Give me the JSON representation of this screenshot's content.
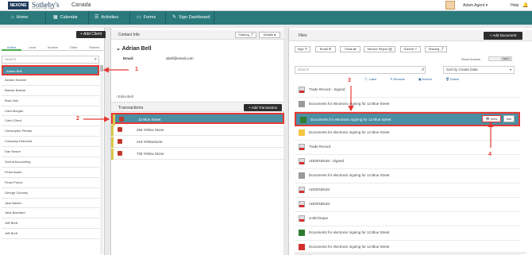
{
  "header": {
    "logo_text": "NEXONE",
    "brand": "Sotheby's",
    "brand_sub": "INTERNATIONAL REALTY",
    "region": "Canada",
    "user_name": "Adam Agent ▾",
    "help": "Help",
    "bell_icon": "bell-icon"
  },
  "nav": {
    "items": [
      {
        "label": "Home",
        "icon": "home-icon"
      },
      {
        "label": "Calendar",
        "icon": "calendar-icon"
      },
      {
        "label": "Activities",
        "icon": "list-icon"
      },
      {
        "label": "Forms",
        "icon": "form-icon"
      },
      {
        "label": "Sign Dashboard",
        "icon": "pen-icon"
      }
    ]
  },
  "clients": {
    "add_label": "+ Add Client",
    "tabs": [
      "Active",
      "Lead",
      "Archive",
      "Other",
      "Shared"
    ],
    "search_placeholder": "Search",
    "selected": "Adrian Bell",
    "list": [
      "Adrian Bell",
      "Ashton Kutcher",
      "Bashar Bashar",
      "Brad Vink",
      "Cara Morgan",
      "Carlo Client",
      "Christopher Pitman",
      "Company Diamond",
      "Dan Nason",
      "Donna Accounting",
      "Finan Awad",
      "Finan Punce",
      "George Clooney",
      "Jack Barker",
      "Jade Bachand",
      "Jeff Brett",
      "Jeff Brett"
    ]
  },
  "contact": {
    "title": "Contact Info",
    "sharing": "Sharing",
    "details": "Details",
    "name": "Adrian Bell",
    "email_label": "Email:",
    "email_value": "abell@email.com",
    "co_name": "Erika Bell"
  },
  "transactions": {
    "title": "Transactions",
    "add_label": "+ Add Transaction",
    "rows": [
      "12 Blue Street",
      "256 Yellow Stone",
      "419 Yellowstone",
      "728 Yellow Stone"
    ]
  },
  "files": {
    "title": "Files",
    "add_label": "+ Add Document",
    "actions": [
      "Sign",
      "Email",
      "Trade",
      "Service Report",
      "Submit",
      "Sharing"
    ],
    "show_archive": "Show Archive",
    "toggle_off": "OFF",
    "search_placeholder": "Search",
    "sort": "Sort by Create Date",
    "columns": [
      "Label",
      "Rename",
      "Archive",
      "Delete"
    ],
    "view": "View",
    "info": "Info",
    "docs": [
      {
        "name": "Trade Record - Signed",
        "icon": "pdf"
      },
      {
        "name": "Documents for electronic signing for 12 Blue Street",
        "icon": "fgray"
      },
      {
        "name": "Documents for electronic signing for 12 Blue Street",
        "icon": "fgreen"
      },
      {
        "name": "Documents for electronic signing for 12 Blue Street",
        "icon": "fyellow"
      },
      {
        "name": "Trade Record",
        "icon": "pdf"
      },
      {
        "name": "ADDENDUM - Signed",
        "icon": "pdf"
      },
      {
        "name": "Documents for electronic signing for 12 Blue Street",
        "icon": "fgray"
      },
      {
        "name": "ADDENDUM",
        "icon": "pdf"
      },
      {
        "name": "ADDENDUM",
        "icon": "pdf"
      },
      {
        "name": "voidCheque",
        "icon": "pdf"
      },
      {
        "name": "Documents for electronic signing for 12 Blue Street",
        "icon": "fgreen"
      },
      {
        "name": "Documents for electronic signing for 12 Blue Street",
        "icon": "fred"
      }
    ]
  },
  "annotations": [
    "1",
    "2",
    "3",
    "4"
  ]
}
